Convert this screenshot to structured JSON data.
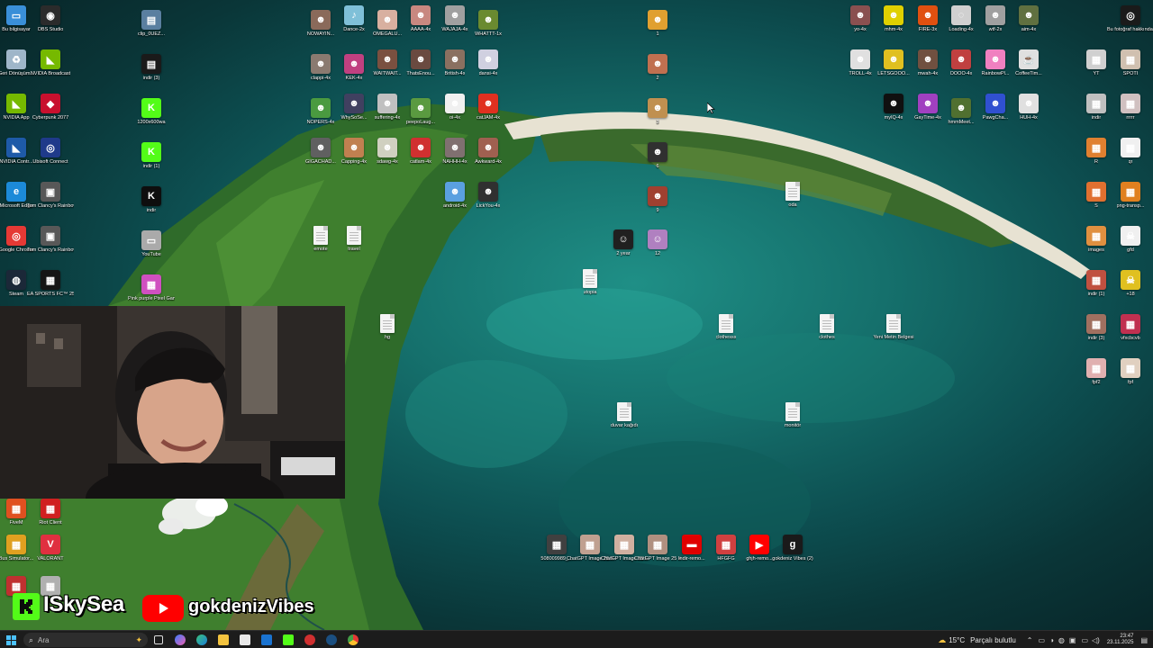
{
  "desktop": {
    "icons": [
      {
        "label": "Bu bilgisayar",
        "color": "#3a8fd8",
        "glyph": "▭"
      },
      {
        "label": "OBS Studio",
        "color": "#2b2b2b",
        "glyph": "◉"
      },
      {
        "label": "Geri Dönüşüm...",
        "color": "#9fb6c9",
        "glyph": "♻"
      },
      {
        "label": "NVIDIA Broadcast",
        "color": "#76b900",
        "glyph": "◣"
      },
      {
        "label": "NVIDIA App",
        "color": "#76b900",
        "glyph": "◣"
      },
      {
        "label": "Cyberpunk 2077",
        "color": "#c8102e",
        "glyph": "◆"
      },
      {
        "label": "NVIDIA Contr...",
        "color": "#1e5aa8",
        "glyph": "◣"
      },
      {
        "label": "Ubisoft Connect",
        "color": "#1f3a8a",
        "glyph": "◎"
      },
      {
        "label": "Microsoft Edge",
        "color": "#1c8ad8",
        "glyph": "e"
      },
      {
        "label": "Tom Clancy's Rainbow Si...",
        "color": "#585858",
        "glyph": "▣"
      },
      {
        "label": "Google Chrome",
        "color": "#e53935",
        "glyph": "◎"
      },
      {
        "label": "Tom Clancy's Rainbow Si...",
        "color": "#585858",
        "glyph": "▣"
      },
      {
        "label": "Steam",
        "color": "#1b2838",
        "glyph": "◍"
      },
      {
        "label": "EA SPORTS FC™ 25",
        "color": "#151515",
        "glyph": "▦"
      },
      {
        "label": "clip_0UEZ...",
        "color": "#5a7fa0",
        "glyph": "▤"
      },
      {
        "label": "indir (3)",
        "color": "#1a1a1a",
        "glyph": "▤"
      },
      {
        "label": "1200x600wa",
        "color": "#53fc18",
        "glyph": "K"
      },
      {
        "label": "indir (1)",
        "color": "#53fc18",
        "glyph": "K"
      },
      {
        "label": "indir",
        "color": "#0e0e0e",
        "glyph": "K"
      },
      {
        "label": "YouTube",
        "color": "#aaaaaa",
        "glyph": "▭"
      },
      {
        "label": "Pink purple Pixel Gam...",
        "color": "#d050c0",
        "glyph": "▦"
      },
      {
        "label": "NOWAYIN...",
        "color": "#8a6a5a",
        "glyph": "☻"
      },
      {
        "label": "Dance-2x",
        "color": "#7fc0d8",
        "glyph": "♪"
      },
      {
        "label": "OMEGALU...",
        "color": "#d8b0a0",
        "glyph": "☻"
      },
      {
        "label": "AAAA-4x",
        "color": "#c88880",
        "glyph": "☻"
      },
      {
        "label": "WAJAJA-4x",
        "color": "#a0a0a0",
        "glyph": "☻"
      },
      {
        "label": "WHATTT-1x",
        "color": "#6a8a30",
        "glyph": "☻"
      },
      {
        "label": "clappi-4x",
        "color": "#8a7a70",
        "glyph": "☻"
      },
      {
        "label": "KEK-4x",
        "color": "#c04080",
        "glyph": "☻"
      },
      {
        "label": "WAITWAIT...",
        "color": "#7a5040",
        "glyph": "☻"
      },
      {
        "label": "ThatsEnou...",
        "color": "#6a4a40",
        "glyph": "☻"
      },
      {
        "label": "British-4x",
        "color": "#8a7060",
        "glyph": "☻"
      },
      {
        "label": "dansi-4x",
        "color": "#d0d0e0",
        "glyph": "☻"
      },
      {
        "label": "NOPERS-4x",
        "color": "#4a9a40",
        "glyph": "☻"
      },
      {
        "label": "WhySoSe...",
        "color": "#404060",
        "glyph": "☻"
      },
      {
        "label": "suffering-4x",
        "color": "#c0c0c0",
        "glyph": "☻"
      },
      {
        "label": "peepoLaug...",
        "color": "#5a9a40",
        "glyph": "☻"
      },
      {
        "label": "oi-4x",
        "color": "#f0f0f0",
        "glyph": "☻"
      },
      {
        "label": "catJAM-4x",
        "color": "#e03020",
        "glyph": "☻"
      },
      {
        "label": "GIGACHAD...",
        "color": "#606060",
        "glyph": "☻"
      },
      {
        "label": "Capping-4x",
        "color": "#c08050",
        "glyph": "☻"
      },
      {
        "label": "sdawg-4x",
        "color": "#d0d0c0",
        "glyph": "☻"
      },
      {
        "label": "catlam-4x",
        "color": "#d03030",
        "glyph": "☻"
      },
      {
        "label": "NAHHH-4x",
        "color": "#807070",
        "glyph": "☻"
      },
      {
        "label": "Awkward-4x",
        "color": "#a06050",
        "glyph": "☻"
      },
      {
        "label": "android-4x",
        "color": "#5aa0e0",
        "glyph": "☻"
      },
      {
        "label": "LickYou-4x",
        "color": "#303030",
        "glyph": "☻"
      },
      {
        "label": "emote",
        "doc": true
      },
      {
        "label": "travel",
        "doc": true
      },
      {
        "label": "hg",
        "doc": true
      },
      {
        "label": "1",
        "color": "#e0a030",
        "glyph": "☻"
      },
      {
        "label": "2",
        "color": "#c07050",
        "glyph": "☻"
      },
      {
        "label": "3",
        "color": "#c09050",
        "glyph": "☻"
      },
      {
        "label": "6",
        "color": "#303030",
        "glyph": "☻"
      },
      {
        "label": "9",
        "color": "#a04030",
        "glyph": "☻"
      },
      {
        "label": "2 year",
        "color": "#202020",
        "glyph": "☺"
      },
      {
        "label": "12",
        "color": "#b080c0",
        "glyph": "☺"
      },
      {
        "label": "utopia",
        "doc": true
      },
      {
        "label": "oda",
        "doc": true
      },
      {
        "label": "clothesss",
        "doc": true
      },
      {
        "label": "clothes",
        "doc": true
      },
      {
        "label": "Yeni Metin Belgesi",
        "doc": true
      },
      {
        "label": "duvar kağıdı",
        "doc": true
      },
      {
        "label": "monitör",
        "doc": true
      },
      {
        "label": "508009989_...",
        "color": "#404040",
        "glyph": "▦"
      },
      {
        "label": "ChatGPT Image 25 H...",
        "color": "#c0a090",
        "glyph": "▦"
      },
      {
        "label": "ChatGPT Image 25 H...",
        "color": "#d0b0a0",
        "glyph": "▦"
      },
      {
        "label": "ChatGPT Image 25 H...",
        "color": "#b09080",
        "glyph": "▦"
      },
      {
        "label": "indir-remo...",
        "color": "#e00000",
        "glyph": "▬"
      },
      {
        "label": "HFGFG",
        "color": "#d04040",
        "glyph": "▦"
      },
      {
        "label": "ghjh-remo...",
        "color": "#ff0000",
        "glyph": "▶"
      },
      {
        "label": "gokdeniz Vibes (2)",
        "color": "#1a1a1a",
        "glyph": "g"
      },
      {
        "label": "yo-4x",
        "color": "#8a5050",
        "glyph": "☻"
      },
      {
        "label": "mhm-4x",
        "color": "#e0d000",
        "glyph": "☻"
      },
      {
        "label": "FIRE-3x",
        "color": "#e05010",
        "glyph": "☻"
      },
      {
        "label": "Loading-4x",
        "color": "#d0d0d0",
        "glyph": "◌"
      },
      {
        "label": "wtf-2x",
        "color": "#a0a0a0",
        "glyph": "☻"
      },
      {
        "label": "aim-4x",
        "color": "#607040",
        "glyph": "☻"
      },
      {
        "label": "TROLL-4x",
        "color": "#e0e0e0",
        "glyph": "☻"
      },
      {
        "label": "LETSGOOO...",
        "color": "#e0c020",
        "glyph": "☻"
      },
      {
        "label": "mwah-4x",
        "color": "#705040",
        "glyph": "☻"
      },
      {
        "label": "OOOO-4x",
        "color": "#c04040",
        "glyph": "☻"
      },
      {
        "label": "RainbowPl...",
        "color": "#f080c0",
        "glyph": "☻"
      },
      {
        "label": "CoffeeTim...",
        "color": "#e0e0e0",
        "glyph": "☕"
      },
      {
        "label": "myIQ-4x",
        "color": "#101010",
        "glyph": "☻"
      },
      {
        "label": "GayTime-4x",
        "color": "#a040c0",
        "glyph": "☻"
      },
      {
        "label": "hmmMeet...",
        "color": "#507030",
        "glyph": "☻"
      },
      {
        "label": "PawgCha...",
        "color": "#3050d0",
        "glyph": "☻"
      },
      {
        "label": "HUH-4x",
        "color": "#e0e0e0",
        "glyph": "☻"
      },
      {
        "label": "Bu fotoğraf hakkında ...",
        "color": "#1a1a1a",
        "glyph": "◎"
      },
      {
        "label": "YT",
        "color": "#d0d0d0",
        "glyph": "▦"
      },
      {
        "label": "SPOTI",
        "color": "#d0c0b0",
        "glyph": "▦"
      },
      {
        "label": "indir",
        "color": "#c0c0c0",
        "glyph": "▦"
      },
      {
        "label": "rrrrr",
        "color": "#d0c0c0",
        "glyph": "▦"
      },
      {
        "label": "R",
        "color": "#e08030",
        "glyph": "▦"
      },
      {
        "label": "qr",
        "color": "#f0f0f0",
        "glyph": "▦"
      },
      {
        "label": "S",
        "color": "#e07030",
        "glyph": "▦"
      },
      {
        "label": "png-transp...",
        "color": "#e08020",
        "glyph": "▦"
      },
      {
        "label": "images",
        "color": "#e09040",
        "glyph": "▦"
      },
      {
        "label": "gfd",
        "color": "#f0f0f0",
        "glyph": "☠"
      },
      {
        "label": "indir (1)",
        "color": "#c05040",
        "glyph": "▦"
      },
      {
        "label": "+18",
        "color": "#e0c020",
        "glyph": "☠"
      },
      {
        "label": "indir (3)",
        "color": "#a07060",
        "glyph": "▦"
      },
      {
        "label": "vfxcbcvb",
        "color": "#c03050",
        "glyph": "▦"
      },
      {
        "label": "fpf2",
        "color": "#e0b0b0",
        "glyph": "▦"
      },
      {
        "label": "fpf",
        "color": "#e0d0c0",
        "glyph": "▦"
      },
      {
        "label": "FiveM",
        "color": "#e05020",
        "glyph": "▦"
      },
      {
        "label": "Riot Client",
        "color": "#d02020",
        "glyph": "▦"
      },
      {
        "label": "Bus Simulator...",
        "color": "#e0a020",
        "glyph": "▦"
      },
      {
        "label": "VALORANT",
        "color": "#e03040",
        "glyph": "V"
      },
      {
        "label": "",
        "color": "#c03030",
        "glyph": "▦"
      },
      {
        "label": "",
        "color": "#b0b0b0",
        "glyph": "▦"
      }
    ]
  },
  "overlay": {
    "kick_channel": "ISkySea",
    "youtube_channel": "gokdenizVibes",
    "kick_color": "#53fc18",
    "youtube_color": "#ff0000"
  },
  "taskbar": {
    "search_placeholder": "Ara",
    "weather": "15°C",
    "weather_desc": "Parçalı bulutlu",
    "time": "23:47",
    "date": "23.11.2025",
    "pinned": [
      "copilot",
      "edge",
      "files",
      "outlook",
      "store",
      "kick",
      "app",
      "steam",
      "chrome"
    ]
  }
}
